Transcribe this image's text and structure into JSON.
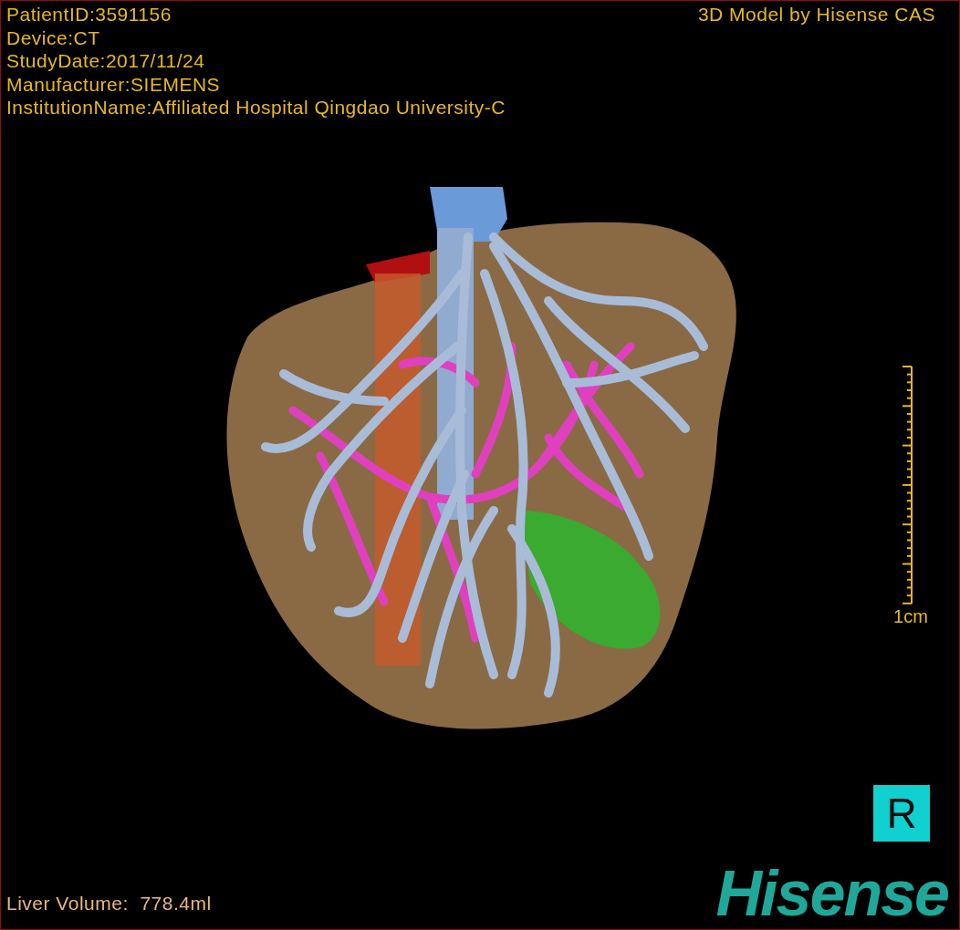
{
  "info_lines": [
    "PatientID:3591156",
    "Device:CT",
    "StudyDate:2017/11/24",
    "Manufacturer:SIEMENS",
    "InstitutionName:Affiliated Hospital Qingdao University-C"
  ],
  "title": "3D Model by Hisense CAS",
  "scale_bar": {
    "label": "1cm"
  },
  "orientation_marker": "R",
  "liver_volume": "Liver Volume:  778.4ml",
  "logo": "Hisense"
}
